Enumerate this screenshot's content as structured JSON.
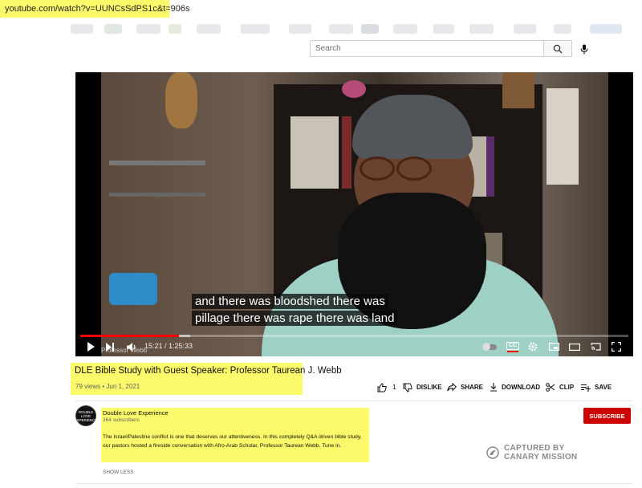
{
  "browser": {
    "url": "youtube.com/watch?v=UUNCsSdPS1c&t=906s"
  },
  "header": {
    "search_placeholder": "Search",
    "icons": [
      "search-icon",
      "mic-icon"
    ]
  },
  "player": {
    "captions": [
      "and there was bloodshed there was",
      "pillage there was rape there was land"
    ],
    "watermark": "Professor Webb",
    "time": "15:21 / 1:25:33",
    "progress": 0.18,
    "loaded": 0.2,
    "controls": [
      "play-icon",
      "next-icon",
      "volume-icon",
      "autoplay-toggle",
      "cc-icon",
      "settings-icon",
      "miniplayer-icon",
      "theater-icon",
      "cast-icon",
      "fullscreen-icon"
    ],
    "cc_label": "CC",
    "accent": "#ff0000"
  },
  "video": {
    "title": "DLE Bible Study with Guest Speaker: Professor Taurean J. Webb",
    "meta": "79 views • Jun 1, 2021",
    "actions": {
      "like": "1",
      "dislike": "DISLIKE",
      "share": "SHARE",
      "download": "DOWNLOAD",
      "clip": "CLIP",
      "save": "SAVE"
    }
  },
  "channel": {
    "name": "Double Love Experience",
    "subscribers": "264 subscribers",
    "avatar_text": "DOUBLE LOVE EXPERIENCE",
    "subscribe_label": "SUBSCRIBE",
    "subscribe_color": "#cc0000"
  },
  "description": {
    "text": "The Israel/Palestine conflict is one that deserves our attentiveness. In this completely Q&A driven bible study, our pastors hosted a fireside conversation with Afro-Arab Scholar, Professor Taurean Webb. Tune in.",
    "show_less": "SHOW LESS"
  },
  "overlay": {
    "captured_line1": "CAPTURED BY",
    "captured_line2": "CANARY MISSION"
  },
  "highlight_color": "#fbfa6a"
}
